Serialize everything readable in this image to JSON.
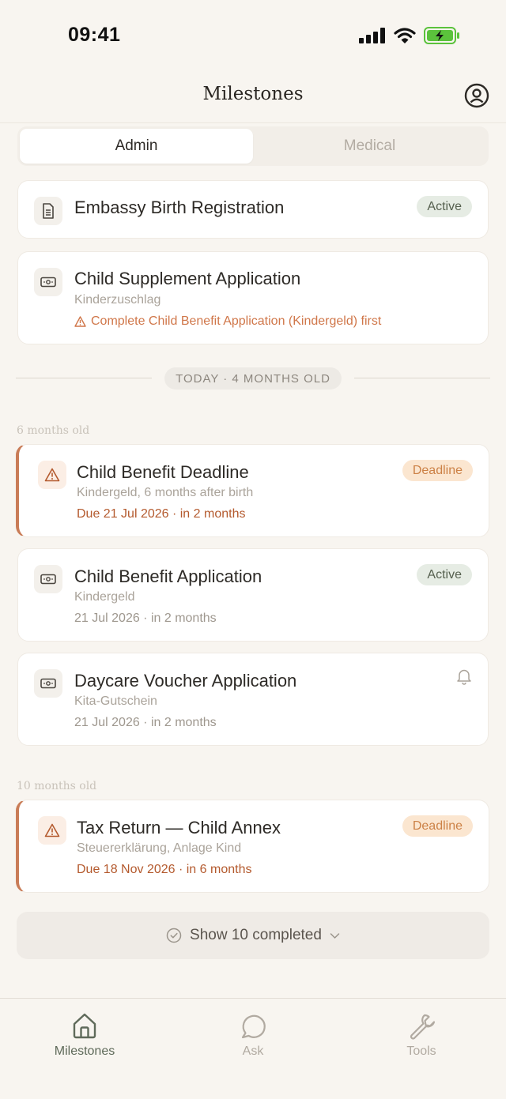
{
  "status_bar": {
    "time": "09:41"
  },
  "header": {
    "title": "Milestones"
  },
  "segments": [
    {
      "label": "Admin",
      "active": true
    },
    {
      "label": "Medical",
      "active": false
    }
  ],
  "top_cards": [
    {
      "title": "Embassy Birth Registration",
      "badge": "Active",
      "icon": "document-icon"
    },
    {
      "title": "Child Supplement Application",
      "subtitle": "Kinderzuschlag",
      "warning": "Complete Child Benefit Application (Kindergeld) first",
      "icon": "money-icon"
    }
  ],
  "today_label": "TODAY · 4 MONTHS OLD",
  "groups": [
    {
      "label": "6 months old",
      "cards": [
        {
          "title": "Child Benefit Deadline",
          "subtitle": "Kindergeld, 6 months after birth",
          "date": "Due 21 Jul 2026 · in 2 months",
          "badge": "Deadline",
          "type": "deadline",
          "icon": "warning-icon"
        },
        {
          "title": "Child Benefit Application",
          "subtitle": "Kindergeld",
          "date": "21 Jul 2026 · in 2 months",
          "badge": "Active",
          "type": "task",
          "icon": "money-icon"
        },
        {
          "title": "Daycare Voucher Application",
          "subtitle": "Kita-Gutschein",
          "date": "21 Jul 2026 · in 2 months",
          "type": "task",
          "icon": "money-icon",
          "trailing_icon": "bell-icon"
        }
      ]
    },
    {
      "label": "10 months old",
      "cards": [
        {
          "title": "Tax Return — Child Annex",
          "subtitle": "Steuererklärung, Anlage Kind",
          "date": "Due 18 Nov 2026 · in 6 months",
          "badge": "Deadline",
          "type": "deadline",
          "icon": "warning-icon"
        }
      ]
    }
  ],
  "show_completed": "Show 10 completed",
  "tabs": [
    {
      "label": "Milestones",
      "icon": "home-icon",
      "active": true
    },
    {
      "label": "Ask",
      "icon": "chat-icon",
      "active": false
    },
    {
      "label": "Tools",
      "icon": "wrench-icon",
      "active": false
    }
  ],
  "colors": {
    "background": "#f8f5f0",
    "accent_deadline": "#c97c57",
    "active_badge": "#e6ece4",
    "deadline_badge": "#fbe6d0",
    "active_tab": "#5f6a5a"
  }
}
